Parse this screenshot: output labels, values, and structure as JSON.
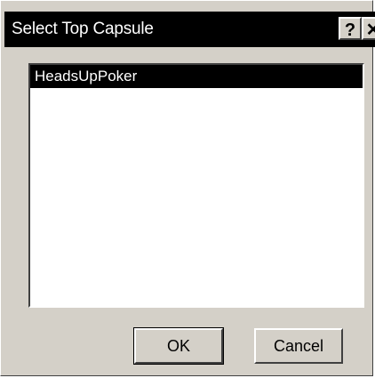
{
  "window": {
    "title": "Select Top Capsule",
    "help_glyph": "?",
    "close_glyph": "✕"
  },
  "list": {
    "items": [
      {
        "label": "HeadsUpPoker",
        "selected": true
      }
    ]
  },
  "buttons": {
    "ok_label": "OK",
    "cancel_label": "Cancel"
  },
  "colors": {
    "dialog_face": "#d4d0c8",
    "titlebar": "#000000",
    "selection": "#000000",
    "list_background": "#ffffff"
  }
}
